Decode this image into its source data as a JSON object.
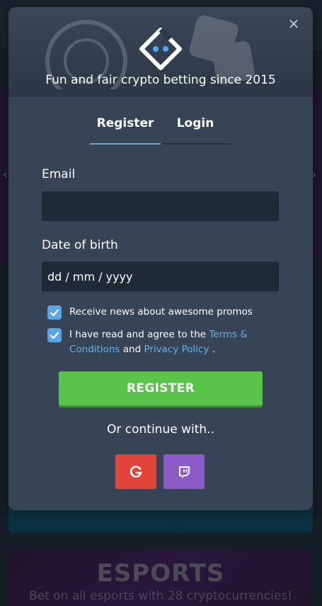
{
  "header": {
    "tagline": "Fun and fair crypto betting since 2015",
    "close_symbol": "×"
  },
  "tabs": [
    {
      "label": "Register",
      "active": true
    },
    {
      "label": "Login",
      "active": false
    }
  ],
  "form": {
    "email_label": "Email",
    "email_value": "",
    "dob_label": "Date of birth",
    "dob_placeholder": "dd / mm / yyyy",
    "promos_checkbox": {
      "checked": true,
      "text": "Receive news about awesome promos"
    },
    "terms_checkbox": {
      "checked": true,
      "prefix": "I have read and agree to the ",
      "terms_link": "Terms & Conditions",
      "middle": " and ",
      "privacy_link": "Privacy Policy",
      "suffix": " ."
    },
    "register_button": "REGISTER",
    "or_continue": "Or continue with.."
  },
  "social": [
    {
      "name": "Google",
      "icon": "google-g-icon",
      "color": "#e0443b"
    },
    {
      "name": "Twitch",
      "icon": "twitch-icon",
      "color": "#8b5bc6"
    }
  ],
  "background": {
    "esports_title": "ESPORTS",
    "esports_subtitle": "Bet on all esports with 28 cryptocurrencies!"
  },
  "colors": {
    "accent_green": "#5ac44a",
    "link_blue": "#6aaee8",
    "modal_bg": "#364456",
    "input_bg": "#1f2a37"
  }
}
